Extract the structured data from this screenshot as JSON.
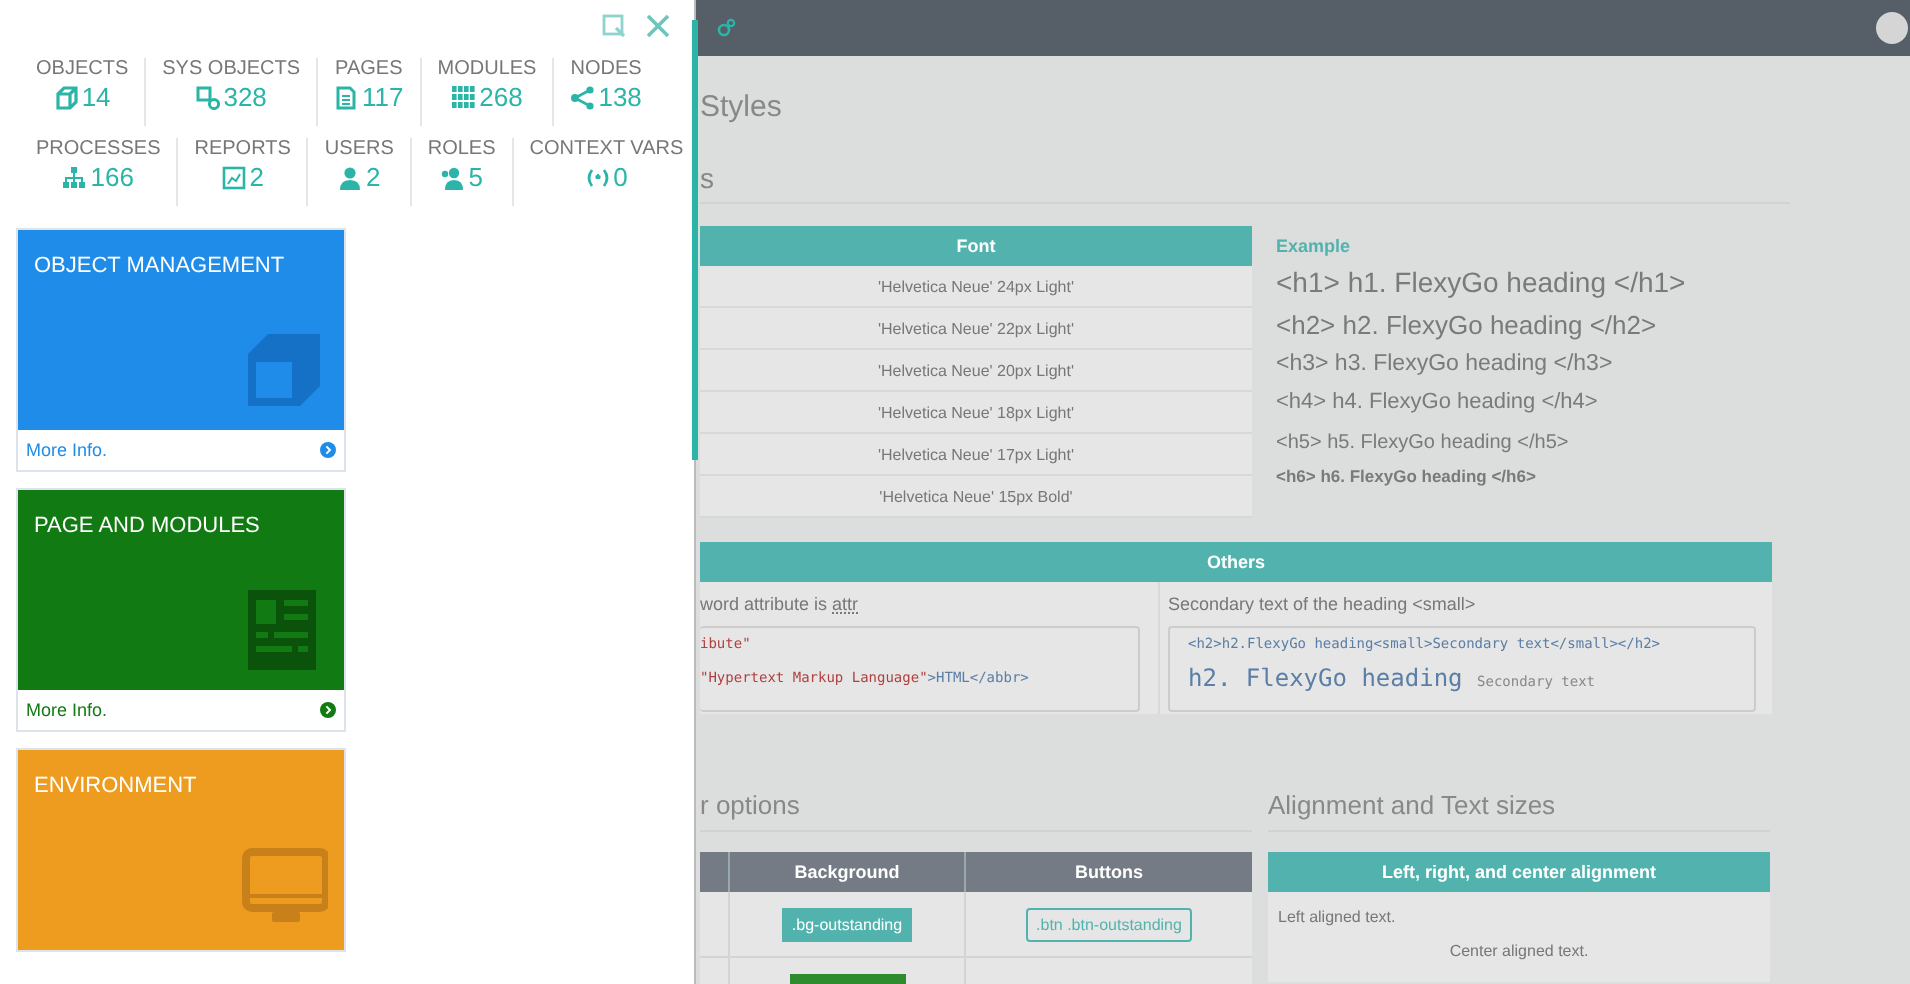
{
  "panel": {
    "stats": [
      [
        {
          "label": "OBJECTS",
          "value": "14"
        },
        {
          "label": "SYS OBJECTS",
          "value": "328"
        },
        {
          "label": "PAGES",
          "value": "117"
        },
        {
          "label": "MODULES",
          "value": "268"
        },
        {
          "label": "NODES",
          "value": "138"
        }
      ],
      [
        {
          "label": "PROCESSES",
          "value": "166"
        },
        {
          "label": "REPORTS",
          "value": "2"
        },
        {
          "label": "USERS",
          "value": "2"
        },
        {
          "label": "ROLES",
          "value": "5"
        },
        {
          "label": "CONTEXT VARS",
          "value": "0"
        }
      ]
    ],
    "tiles": [
      {
        "title": "OBJECT MANAGEMENT",
        "color": "#1e8ce8",
        "footer": "More Info."
      },
      {
        "title": "PAGE AND MODULES",
        "color": "#127a12",
        "footer": "More Info."
      },
      {
        "title": "ENVIRONMENT",
        "color": "#ee9c1f"
      }
    ]
  },
  "main": {
    "page_title": "Styles",
    "section_title": "s",
    "font_table": {
      "column": "Font",
      "rows": [
        "'Helvetica Neue' 24px Light'",
        "'Helvetica Neue' 22px Light'",
        "'Helvetica Neue' 20px Light'",
        "'Helvetica Neue' 18px Light'",
        "'Helvetica Neue' 17px Light'",
        "'Helvetica Neue' 15px Bold'"
      ]
    },
    "example": {
      "label": "Example",
      "headings": [
        "<h1> h1. FlexyGo heading </h1>",
        "<h2> h2. FlexyGo heading </h2>",
        "<h3> h3. FlexyGo heading </h3>",
        "<h4> h4. FlexyGo heading </h4>",
        "<h5> h5. FlexyGo heading </h5>",
        "<h6> h6. FlexyGo heading </h6>"
      ]
    },
    "others": {
      "title": "Others",
      "left": {
        "text": "word attribute is ",
        "abbr": "attr",
        "code": [
          [
            {
              "text": "ibute\"",
              "kind": "string"
            }
          ],
          [
            {
              "text": "\"Hypertext Markup Language\"",
              "kind": "string"
            },
            {
              "text": ">HTML</abbr>",
              "kind": "tag"
            }
          ]
        ]
      },
      "right": {
        "text": "Secondary text of the heading <small>",
        "code": "<h2>h2.FlexyGo heading<small>Secondary text</small></h2>",
        "demo": "h2. FlexyGo heading",
        "demo_small": "Secondary text"
      }
    },
    "color_options": {
      "title": "r options",
      "columns": [
        "Background",
        "Buttons"
      ],
      "rows": [
        {
          "background": {
            "label": ".bg-outstanding",
            "color": "#52b3ae"
          },
          "button": ".btn .btn-outstanding"
        },
        {
          "background": {
            "color": "#2e8b2e"
          }
        }
      ]
    },
    "alignment": {
      "title": "Alignment and Text sizes",
      "header": "Left, right, and center alignment",
      "lines": [
        {
          "text": "Left aligned text.",
          "kind": "left"
        },
        {
          "text": "Center aligned text.",
          "kind": "center"
        }
      ]
    }
  }
}
